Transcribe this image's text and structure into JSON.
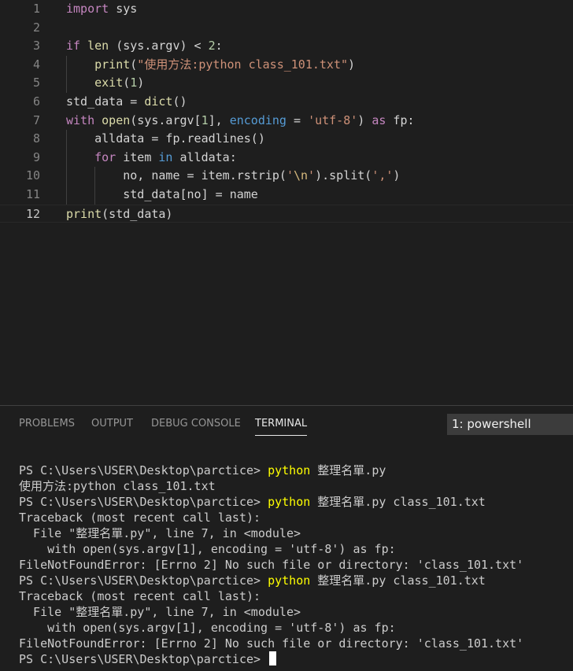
{
  "editor": {
    "lines": [
      {
        "num": "1",
        "t": [
          {
            "c": "k",
            "v": "import"
          },
          {
            "c": "t",
            "v": " sys"
          }
        ]
      },
      {
        "num": "2",
        "t": []
      },
      {
        "num": "3",
        "t": [
          {
            "c": "k",
            "v": "if"
          },
          {
            "c": "t",
            "v": " "
          },
          {
            "c": "f",
            "v": "len"
          },
          {
            "c": "t",
            "v": " (sys.argv) < "
          },
          {
            "c": "n",
            "v": "2"
          },
          {
            "c": "t",
            "v": ":"
          }
        ]
      },
      {
        "num": "4",
        "t": [
          {
            "c": "f",
            "v": "print"
          },
          {
            "c": "t",
            "v": "("
          },
          {
            "c": "s",
            "v": "\"使用方法:python class_101.txt\""
          },
          {
            "c": "t",
            "v": ")"
          }
        ]
      },
      {
        "num": "5",
        "t": [
          {
            "c": "f",
            "v": "exit"
          },
          {
            "c": "t",
            "v": "("
          },
          {
            "c": "n",
            "v": "1"
          },
          {
            "c": "t",
            "v": ")"
          }
        ]
      },
      {
        "num": "6",
        "t": [
          {
            "c": "t",
            "v": "std_data = "
          },
          {
            "c": "f",
            "v": "dict"
          },
          {
            "c": "t",
            "v": "()"
          }
        ]
      },
      {
        "num": "7",
        "t": [
          {
            "c": "k",
            "v": "with"
          },
          {
            "c": "t",
            "v": " "
          },
          {
            "c": "f",
            "v": "open"
          },
          {
            "c": "t",
            "v": "(sys.argv["
          },
          {
            "c": "n",
            "v": "1"
          },
          {
            "c": "t",
            "v": "], "
          },
          {
            "c": "b",
            "v": "encoding"
          },
          {
            "c": "t",
            "v": " = "
          },
          {
            "c": "s",
            "v": "'utf-8'"
          },
          {
            "c": "t",
            "v": ") "
          },
          {
            "c": "k",
            "v": "as"
          },
          {
            "c": "t",
            "v": " fp:"
          }
        ]
      },
      {
        "num": "8",
        "t": [
          {
            "c": "t",
            "v": "alldata = fp.readlines()"
          }
        ]
      },
      {
        "num": "9",
        "t": [
          {
            "c": "k",
            "v": "for"
          },
          {
            "c": "t",
            "v": " item "
          },
          {
            "c": "b",
            "v": "in"
          },
          {
            "c": "t",
            "v": " alldata:"
          }
        ]
      },
      {
        "num": "10",
        "t": [
          {
            "c": "t",
            "v": "no, name = item.rstrip("
          },
          {
            "c": "s",
            "v": "'"
          },
          {
            "c": "e",
            "v": "\\n"
          },
          {
            "c": "s",
            "v": "'"
          },
          {
            "c": "t",
            "v": ").split("
          },
          {
            "c": "s",
            "v": "','"
          },
          {
            "c": "t",
            "v": ")"
          }
        ]
      },
      {
        "num": "11",
        "t": [
          {
            "c": "t",
            "v": "std_data[no] = name"
          }
        ]
      },
      {
        "num": "12",
        "t": [
          {
            "c": "f",
            "v": "print"
          },
          {
            "c": "t",
            "v": "(std_data)"
          }
        ]
      }
    ]
  },
  "panel": {
    "tabs": [
      {
        "label": "PROBLEMS"
      },
      {
        "label": "OUTPUT"
      },
      {
        "label": "DEBUG CONSOLE"
      },
      {
        "label": "TERMINAL"
      }
    ],
    "terminal_select": "1: powershell"
  },
  "terminal": {
    "lines": [
      {
        "p": "PS C:\\Users\\USER\\Desktop\\parctice> ",
        "c": "python",
        "r": " 整理名單.py"
      },
      {
        "p": "使用方法:python class_101.txt"
      },
      {
        "p": "PS C:\\Users\\USER\\Desktop\\parctice> ",
        "c": "python",
        "r": " 整理名單.py class_101.txt"
      },
      {
        "p": "Traceback (most recent call last):"
      },
      {
        "p": "  File \"整理名單.py\", line 7, in <module>"
      },
      {
        "p": "    with open(sys.argv[1], encoding = 'utf-8') as fp:"
      },
      {
        "p": "FileNotFoundError: [Errno 2] No such file or directory: 'class_101.txt'"
      },
      {
        "p": "PS C:\\Users\\USER\\Desktop\\parctice> ",
        "c": "python",
        "r": " 整理名單.py class_101.txt"
      },
      {
        "p": "Traceback (most recent call last):"
      },
      {
        "p": "  File \"整理名單.py\", line 7, in <module>"
      },
      {
        "p": "    with open(sys.argv[1], encoding = 'utf-8') as fp:"
      },
      {
        "p": "FileNotFoundError: [Errno 2] No such file or directory: 'class_101.txt'"
      },
      {
        "p": "PS C:\\Users\\USER\\Desktop\\parctice> "
      }
    ]
  },
  "colors": {
    "background": "#1e1e1e",
    "keyword": "#c586c0",
    "builtin": "#569cd6",
    "function": "#dcdcaa",
    "string": "#ce9178",
    "number": "#b5cea8",
    "terminal_command": "#ffff00"
  }
}
